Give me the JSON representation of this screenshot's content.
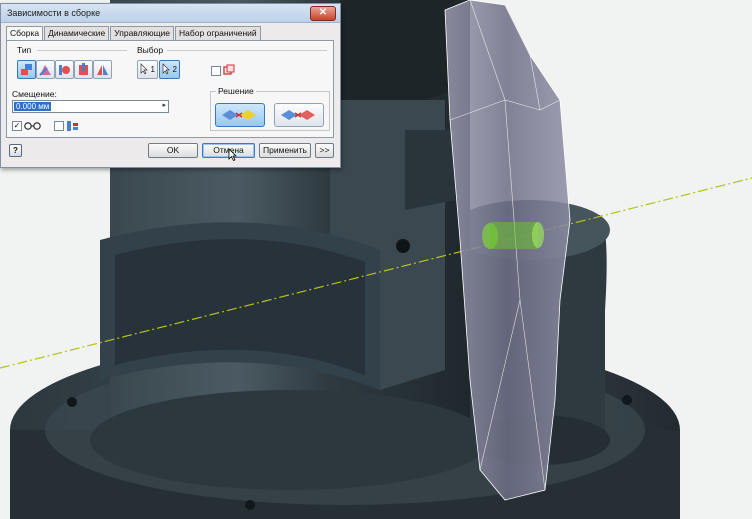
{
  "dialog": {
    "title": "Зависимости в сборке",
    "close_icon": "close-icon",
    "tabs": [
      "Сборка",
      "Динамические",
      "Управляющие",
      "Набор ограничений"
    ],
    "active_tab": "Сборка",
    "type_group": {
      "label": "Тип",
      "buttons": [
        "mate-icon",
        "angle-icon",
        "tangent-icon",
        "insert-icon",
        "symmetry-icon"
      ],
      "selected": "mate-icon"
    },
    "selection_group": {
      "label": "Выбор",
      "buttons": [
        {
          "icon": "select-arrow-icon",
          "number": "1"
        },
        {
          "icon": "select-arrow-icon",
          "number": "2"
        }
      ],
      "selected_number": "2",
      "pick_part_first_checked": false,
      "pick_part_first_icon": "pick-part-first-icon"
    },
    "offset": {
      "label": "Смещение:",
      "value": "0.000 мм"
    },
    "options": {
      "show_preview_checked": true,
      "show_preview_icon": "glasses-icon",
      "predict_offset_checked": false,
      "predict_offset_icon": "predict-offset-icon"
    },
    "solution_group": {
      "label": "Решение",
      "buttons": [
        "mate-solution-icon",
        "flush-solution-icon"
      ],
      "selected": "mate-solution-icon"
    },
    "footer": {
      "help_icon": "help-icon",
      "ok_label": "OK",
      "cancel_label": "Отмена",
      "apply_label": "Применить",
      "expand_label": ">>"
    }
  },
  "colors": {
    "selection_blue": "#2f6fcc",
    "part_dark": "#2f3b41",
    "ghost_part": "#7a7c93",
    "axis_line": "#b4c414",
    "preview_green": "#7fd43a"
  }
}
